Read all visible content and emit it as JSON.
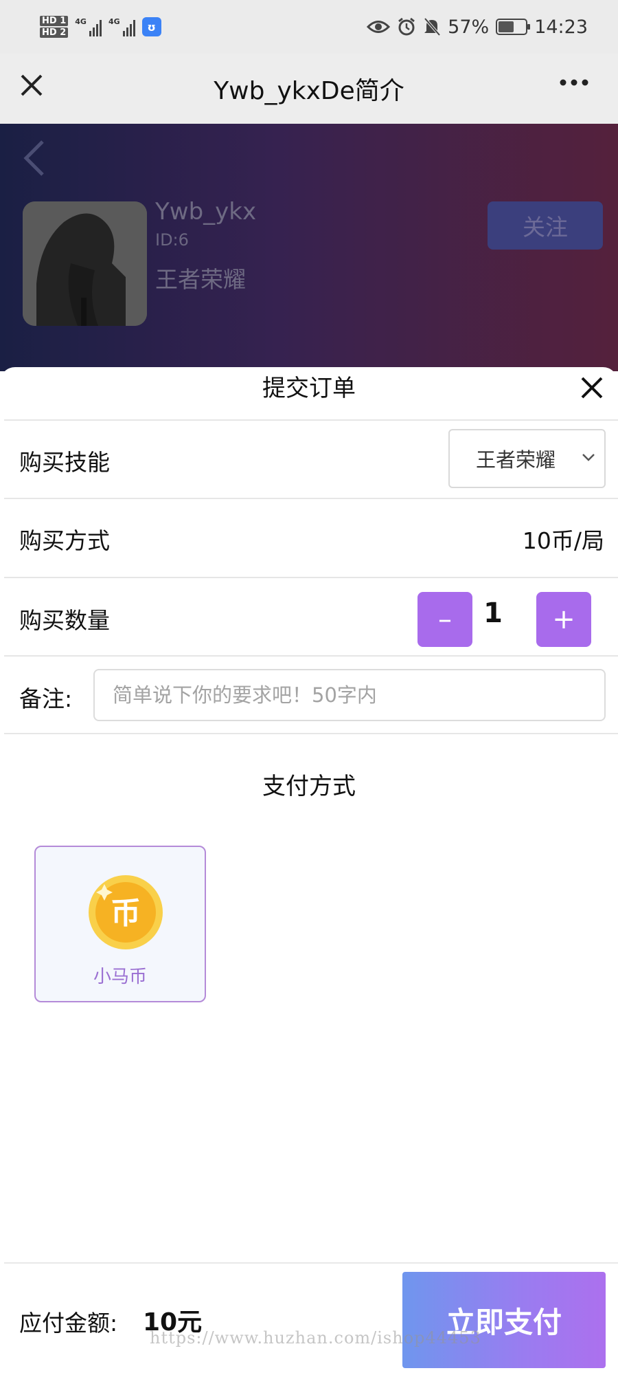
{
  "status_bar": {
    "hd1": "HD 1",
    "hd2": "HD 2",
    "net1": "4G",
    "net2": "4G",
    "battery": "57%",
    "battery_level": 0.57,
    "time": "14:23"
  },
  "title_bar": {
    "title": "Ywb_ykxDe简介",
    "close_icon": "close-icon",
    "more_icon": "more-icon"
  },
  "profile": {
    "name": "Ywb_ykx",
    "id": "ID:6",
    "game": "王者荣耀",
    "follow_label": "关注"
  },
  "order": {
    "title": "提交订单",
    "skill_label": "购买技能",
    "skill_value": "王者荣耀",
    "method_label": "购买方式",
    "method_value": "10币/局",
    "quantity_label": "购买数量",
    "quantity_minus": "–",
    "quantity_value": "1",
    "quantity_plus": "+",
    "note_label": "备注:",
    "note_placeholder": "简单说下你的要求吧！50字内",
    "note_value": ""
  },
  "payment": {
    "heading": "支付方式",
    "methods": [
      {
        "label": "小马币",
        "icon": "coin-icon",
        "coin_char": "币",
        "selected": true
      }
    ]
  },
  "footer": {
    "amount_label": "应付金额:",
    "amount_value": "10元",
    "pay_label": "立即支付",
    "watermark": "https://www.huzhan.com/ishop44453"
  },
  "colors": {
    "accent": "#a86bec",
    "pay_gradient_start": "#6f96ee",
    "pay_gradient_end": "#ac70ee",
    "coin": "#f7b928"
  }
}
